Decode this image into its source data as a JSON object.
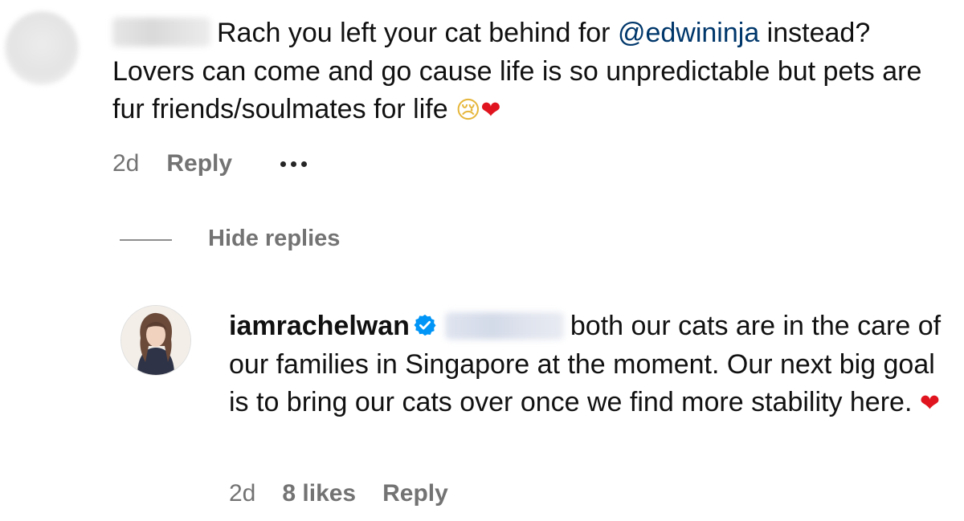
{
  "comment": {
    "text_before_mention": "Rach you left your cat behind for ",
    "mention": "@edwininja",
    "text_after_mention": " instead? Lovers can come and go cause life is so unpredictable but pets are fur friends/soulmates for life ",
    "emojis": [
      "😢",
      "❤"
    ],
    "time": "2d",
    "reply_label": "Reply",
    "more_icon": "more-dots-icon"
  },
  "hide_replies_label": "Hide replies",
  "reply": {
    "username": "iamrachelwan",
    "verified_icon": "verified-badge-icon",
    "text": "both our cats are in the care of our families in Singapore at the moment. Our next big goal is to bring our cats over once we find more stability here. ",
    "emoji": "❤",
    "time": "2d",
    "likes_label": "8 likes",
    "reply_label": "Reply"
  },
  "colors": {
    "mention": "#00376b",
    "meta": "#737373",
    "verified": "#0095f6",
    "heart": "#e0141e"
  }
}
